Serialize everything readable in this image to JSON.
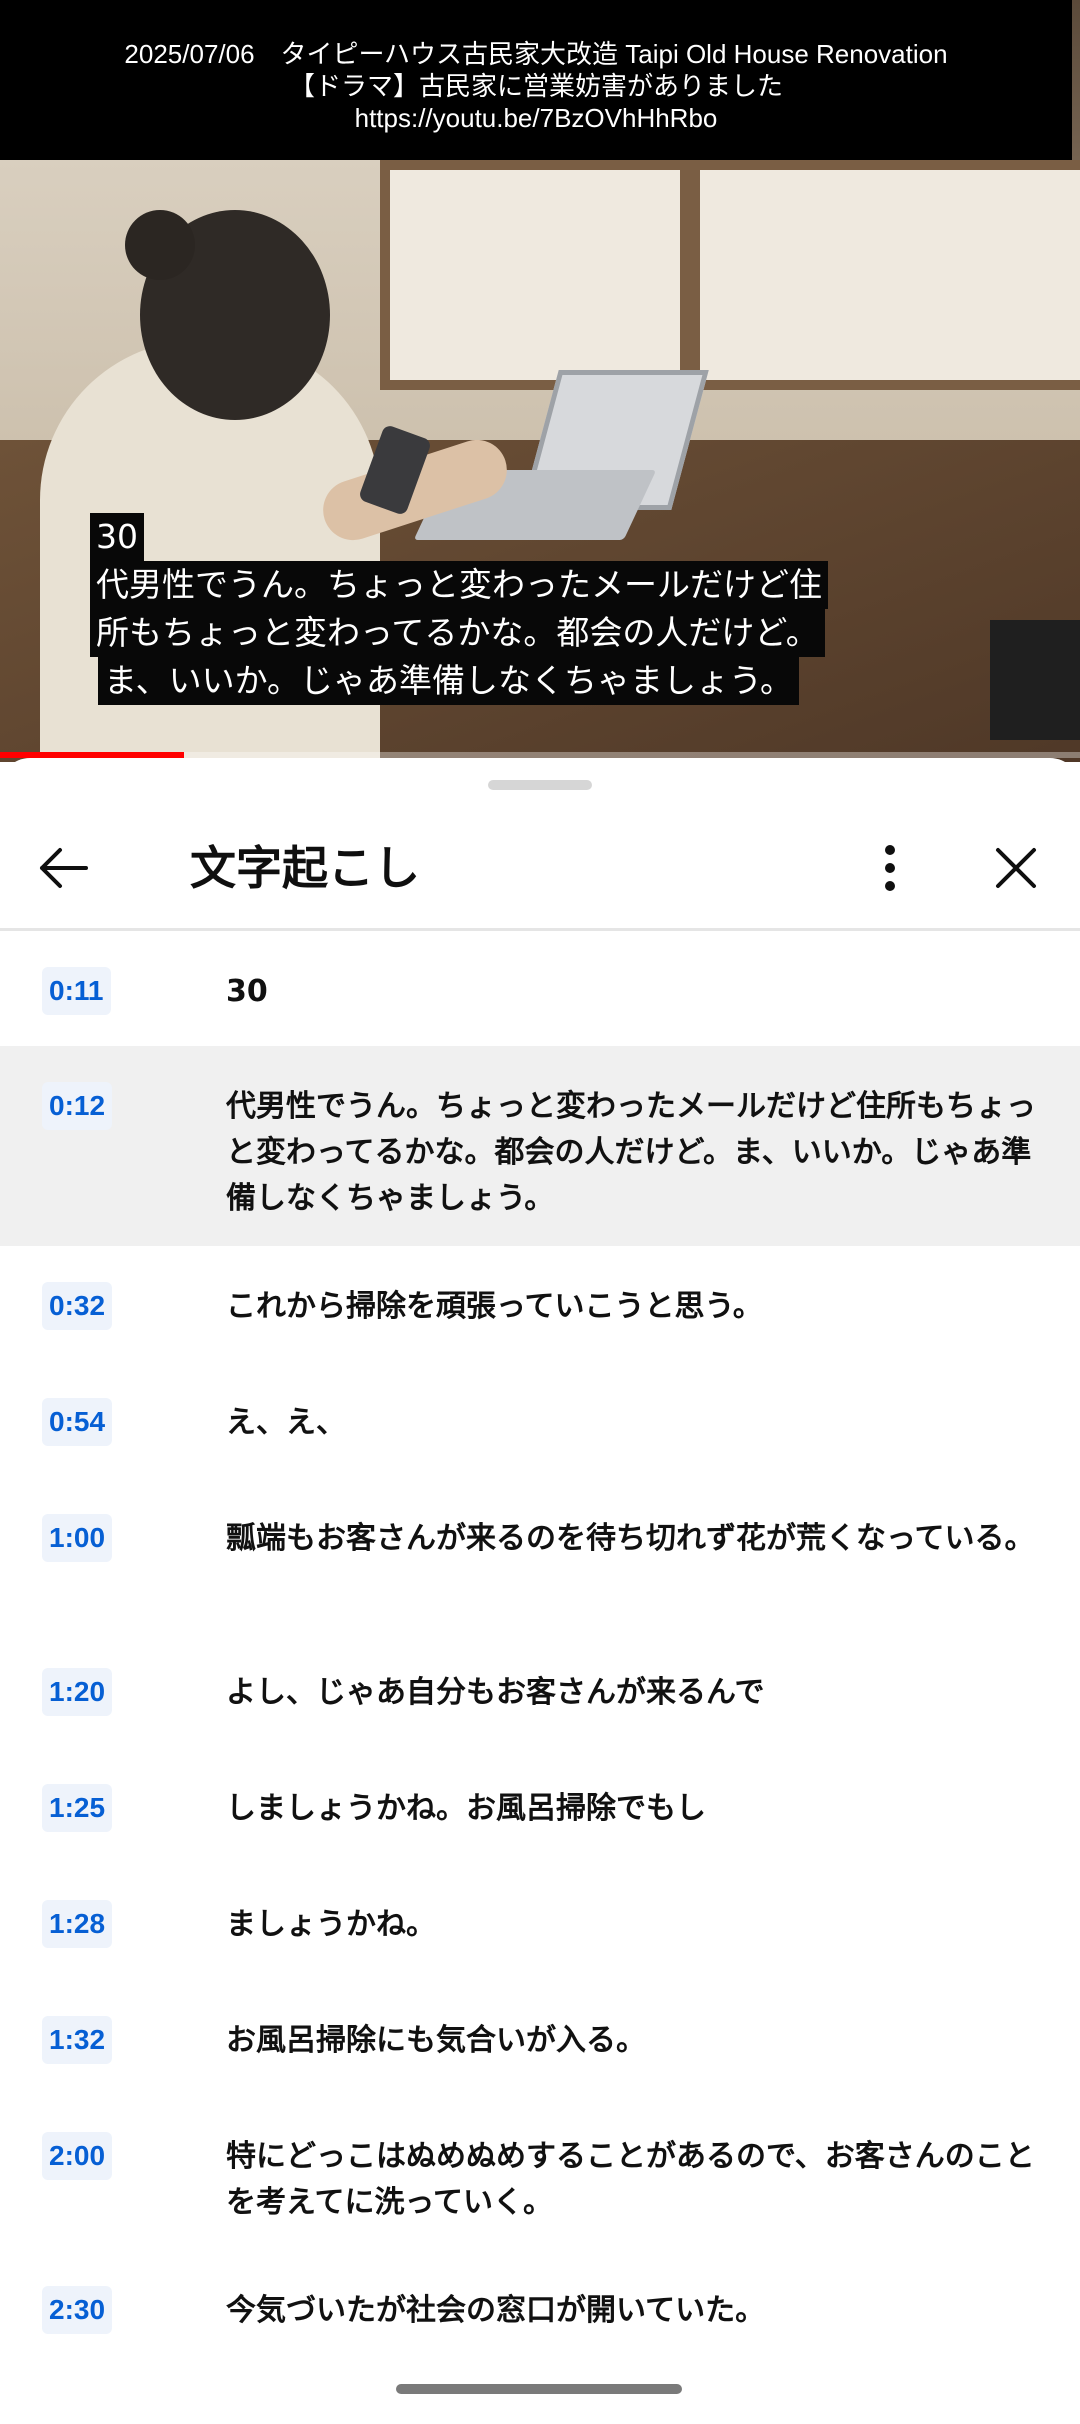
{
  "video": {
    "overlay_lines": [
      "2025/07/06　タイピーハウス古民家大改造 Taipi Old House Renovation",
      "【ドラマ】古民家に営業妨害がありました",
      "https://youtu.be/7BzOVhHhRbo"
    ],
    "caption_lines": [
      "30",
      "代男性でうん。ちょっと変わったメールだけど住",
      "所もちょっと変わってるかな。都会の人だけど。",
      "ま、いいか。じゃあ準備しなくちゃましょう。"
    ],
    "progress_fraction": 0.17,
    "progress_color": "#ff0000"
  },
  "panel": {
    "title": "文字起こし",
    "back_icon": "arrow-left-icon",
    "more_icon": "more-vert-icon",
    "close_icon": "close-icon"
  },
  "segments": [
    {
      "time": "0:11",
      "text": "30"
    },
    {
      "time": "0:12",
      "text": "代男性でうん。ちょっと変わったメールだけど住所もちょっと変わってるかな。都会の人だけど。ま、いいか。じゃあ準備しなくちゃましょう。",
      "active": true
    },
    {
      "time": "0:32",
      "text": "これから掃除を頑張っていこうと思う。"
    },
    {
      "time": "0:54",
      "text": "え、え、"
    },
    {
      "time": "1:00",
      "text": "瓢端もお客さんが来るのを待ち切れず花が荒くなっている。"
    },
    {
      "time": "1:20",
      "text": "よし、じゃあ自分もお客さんが来るんで"
    },
    {
      "time": "1:25",
      "text": "しましょうかね。お風呂掃除でもし"
    },
    {
      "time": "1:28",
      "text": "ましょうかね。"
    },
    {
      "time": "1:32",
      "text": "お風呂掃除にも気合いが入る。"
    },
    {
      "time": "2:00",
      "text": "特にどっこはぬめぬめすることがあるので、お客さんのことを考えてに洗っていく。"
    },
    {
      "time": "2:30",
      "text": "今気づいたが社会の窓口が開いていた。"
    }
  ],
  "colors": {
    "timestamp_text": "#065fd4",
    "timestamp_bg": "#eef3fb",
    "active_row_bg": "#f0f0f0"
  }
}
